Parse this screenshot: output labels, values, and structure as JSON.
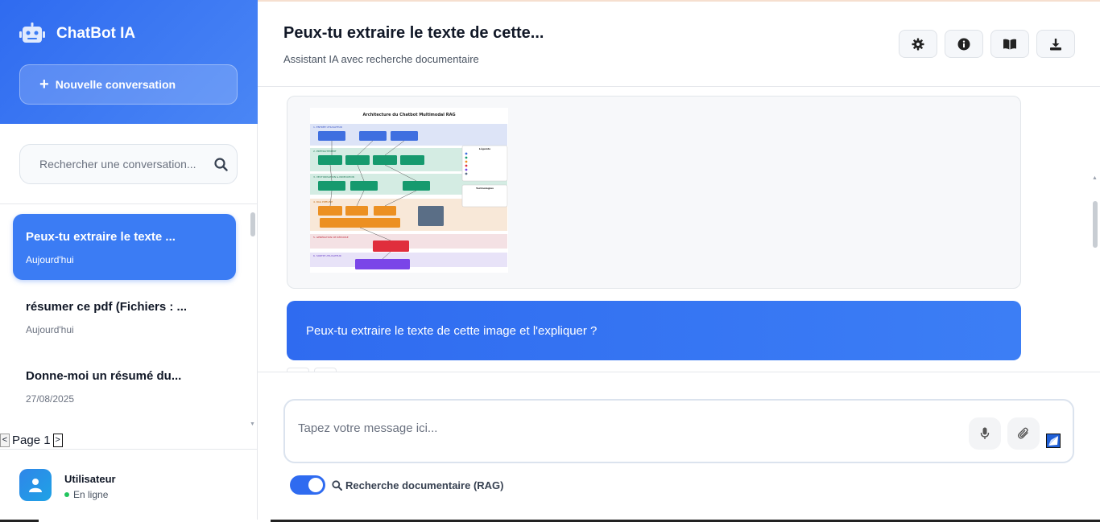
{
  "sidebar": {
    "brand": "ChatBot IA",
    "new_conversation": "Nouvelle conversation",
    "search_placeholder": "Rechercher une conversation...",
    "conversations": [
      {
        "title": "Peux-tu extraire le texte ...",
        "date": "Aujourd'hui",
        "active": true
      },
      {
        "title": "résumer ce pdf (Fichiers : ...",
        "date": "Aujourd'hui",
        "active": false
      },
      {
        "title": "Donne-moi un résumé du...",
        "date": "27/08/2025",
        "active": false
      }
    ],
    "pager": {
      "label": "Page 1",
      "prev": "<",
      "next": ">"
    },
    "user": {
      "name": "Utilisateur",
      "status": "En ligne"
    }
  },
  "header": {
    "title": "Peux-tu extraire le texte de cette...",
    "subtitle": "Assistant IA avec recherche documentaire",
    "actions": [
      "gear-icon",
      "info-icon",
      "book-icon",
      "download-icon"
    ]
  },
  "messages": {
    "image": {
      "title": "Architecture du Chatbot Multimodal RAG",
      "sections": [
        "1. ENTRÉE UTILISATEUR",
        "2. PRÉTRAITEMENT",
        "3. VECTORISATION & INDEXATION",
        "4. RAG PIPELINE",
        "5. GÉNÉRATION DE RÉPONSE",
        "6. SORTIE UTILISATEUR"
      ],
      "legend_title": "Légende",
      "tech_title": "Technologies"
    },
    "user_message": "Peux-tu extraire le texte de cette image et l'expliquer ?"
  },
  "composer": {
    "placeholder": "Tapez votre message ici...",
    "rag_label": "Recherche documentaire (RAG)",
    "rag_enabled": true
  },
  "colors": {
    "accent": "#2f6bf0",
    "online": "#22c55e"
  }
}
